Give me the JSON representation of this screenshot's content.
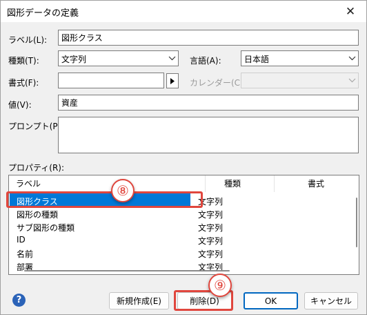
{
  "window": {
    "title": "図形データの定義",
    "close_glyph": "✕"
  },
  "form": {
    "label_label": "ラベル(L):",
    "label_value": "図形クラス",
    "type_label": "種類(T):",
    "type_value": "文字列",
    "language_label": "言語(A):",
    "language_value": "日本語",
    "format_label": "書式(F):",
    "format_value": "",
    "calendar_label": "カレンダー(C):",
    "calendar_value": "",
    "value_label": "値(V):",
    "value_value": "資産",
    "prompt_label": "プロンプト(P):",
    "prompt_value": "",
    "properties_label": "プロパティ(R):"
  },
  "properties": {
    "columns": [
      "ラベル",
      "種類",
      "書式"
    ],
    "rows": [
      {
        "label": "図形クラス",
        "type": "文字列",
        "selected": true
      },
      {
        "label": "図形の種類",
        "type": "文字列"
      },
      {
        "label": "サブ図形の種類",
        "type": "文字列"
      },
      {
        "label": "ID",
        "type": "文字列"
      },
      {
        "label": "名前",
        "type": "文字列"
      },
      {
        "label": "部署",
        "type": "文字列"
      }
    ]
  },
  "buttons": {
    "help": "?",
    "new": "新規作成(E)",
    "delete": "削除(D)",
    "ok": "OK",
    "cancel": "キャンセル"
  },
  "callouts": {
    "c8": "⑧",
    "c9": "⑨"
  },
  "colors": {
    "selection": "#0078d7",
    "callout": "#e0463d",
    "ok_border": "#0067c0",
    "help": "#2b63b8"
  }
}
